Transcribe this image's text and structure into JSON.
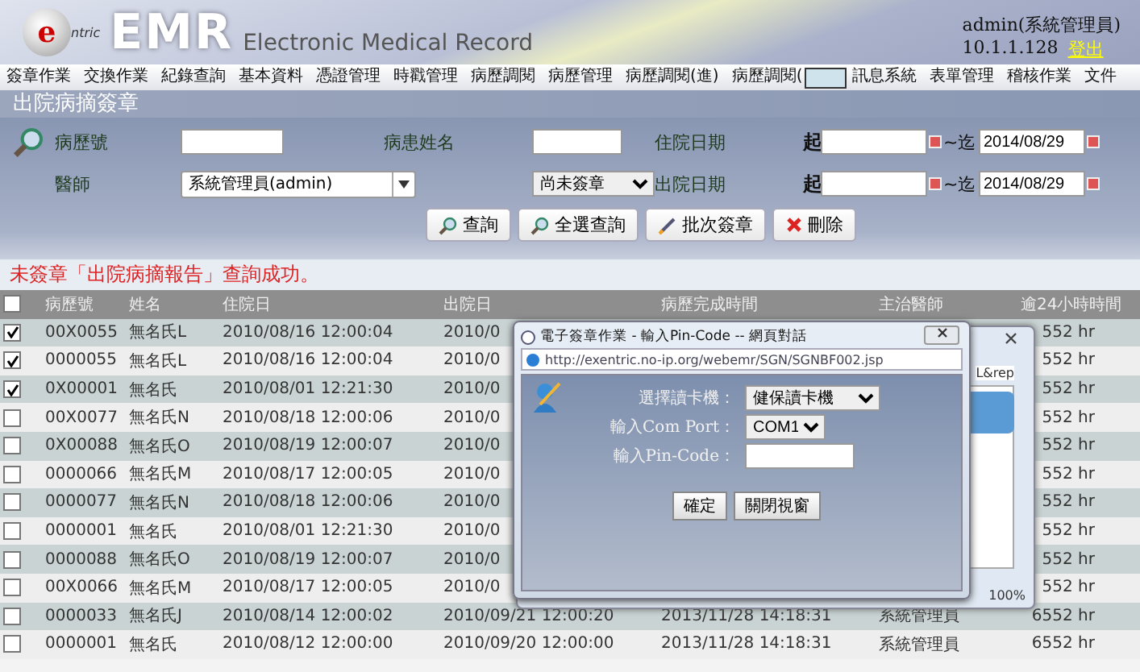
{
  "header": {
    "logo_letter": "e",
    "logo_word": "ntric",
    "product": "EMR",
    "subtitle": "Electronic Medical Record",
    "user": "admin(系統管理員)",
    "ip": "10.1.1.128",
    "logout": "登出"
  },
  "menu": [
    {
      "label": "簽章作業"
    },
    {
      "label": "交換作業"
    },
    {
      "label": "紀錄查詢"
    },
    {
      "label": "基本資料"
    },
    {
      "label": "憑證管理"
    },
    {
      "label": "時戳管理"
    },
    {
      "label": "病歷調閱"
    },
    {
      "label": "病歷管理"
    },
    {
      "label": "病歷調閱(進)"
    },
    {
      "label": "病歷調閱(",
      "covered": true
    },
    {
      "label": "訊息系統"
    },
    {
      "label": "表單管理"
    },
    {
      "label": "稽核作業"
    },
    {
      "label": "文件"
    }
  ],
  "page_title": "出院病摘簽章",
  "filters": {
    "chart_no": {
      "label": "病歷號"
    },
    "patient_name": {
      "label": "病患姓名"
    },
    "admit_date": {
      "label": "住院日期",
      "from_label": "起",
      "to_label": "~迄",
      "to": "2014/08/29"
    },
    "doctor": {
      "label": "醫師",
      "value": "系統管理員(admin)"
    },
    "sign_status": {
      "value": "尚未簽章"
    },
    "discharge_date": {
      "label": "出院日期",
      "from_label": "起",
      "to_label": "~迄",
      "to": "2014/08/29"
    }
  },
  "buttons": [
    {
      "kind": "search",
      "label": "查詢"
    },
    {
      "kind": "search",
      "label": "全選查詢"
    },
    {
      "kind": "sign",
      "label": "批次簽章"
    },
    {
      "kind": "delete",
      "label": "刪除"
    }
  ],
  "message": "未簽章「出院病摘報告」查詢成功。",
  "table": {
    "all_checked": false,
    "columns": [
      "病歷號",
      "姓名",
      "住院日",
      "出院日",
      "病歷完成時間",
      "主治醫師",
      "逾24小時時間"
    ],
    "rows": [
      {
        "checked": true,
        "cells": [
          "00X0055",
          "無名氏L",
          "2010/08/16 12:00:04",
          "2010/0",
          "",
          "",
          "552 hr"
        ]
      },
      {
        "checked": true,
        "cells": [
          "0000055",
          "無名氏L",
          "2010/08/16 12:00:04",
          "2010/0",
          "",
          "",
          "552 hr"
        ]
      },
      {
        "checked": true,
        "cells": [
          "0X00001",
          "無名氏",
          "2010/08/01 12:21:30",
          "2010/0",
          "",
          "",
          "552 hr"
        ]
      },
      {
        "checked": false,
        "cells": [
          "00X0077",
          "無名氏N",
          "2010/08/18 12:00:06",
          "2010/0",
          "",
          "",
          "552 hr"
        ]
      },
      {
        "checked": false,
        "cells": [
          "0X00088",
          "無名氏O",
          "2010/08/19 12:00:07",
          "2010/0",
          "",
          "",
          "552 hr"
        ]
      },
      {
        "checked": false,
        "cells": [
          "0000066",
          "無名氏M",
          "2010/08/17 12:00:05",
          "2010/0",
          "",
          "",
          "552 hr"
        ]
      },
      {
        "checked": false,
        "cells": [
          "0000077",
          "無名氏N",
          "2010/08/18 12:00:06",
          "2010/0",
          "",
          "",
          "552 hr"
        ]
      },
      {
        "checked": false,
        "cells": [
          "0000001",
          "無名氏",
          "2010/08/01 12:21:30",
          "2010/0",
          "",
          "",
          "552 hr"
        ]
      },
      {
        "checked": false,
        "cells": [
          "0000088",
          "無名氏O",
          "2010/08/19 12:00:07",
          "2010/0",
          "",
          "",
          "552 hr"
        ]
      },
      {
        "checked": false,
        "cells": [
          "00X0066",
          "無名氏M",
          "2010/08/17 12:00:05",
          "2010/0",
          "",
          "",
          "552 hr"
        ]
      },
      {
        "checked": false,
        "cells": [
          "0000033",
          "無名氏J",
          "2010/08/14 12:00:02",
          "2010/09/21 12:00:20",
          "2013/11/28 14:18:31",
          "系統管理員",
          "6552 hr"
        ]
      },
      {
        "checked": false,
        "cells": [
          "0000001",
          "無名氏",
          "2010/08/12 12:00:00",
          "2010/09/20 12:00:00",
          "2013/11/28 14:18:31",
          "系統管理員",
          "6552 hr"
        ]
      }
    ]
  },
  "back_window": {
    "address_tail": "L&rep",
    "zoom": "100%"
  },
  "dialog": {
    "title": "電子簽章作業 - 輸入Pin-Code -- 網頁對話",
    "address": "http://exentric.no-ip.org/webemr/SGN/SGNBF002.jsp",
    "reader": {
      "label": "選擇讀卡機：",
      "value": "健保讀卡機"
    },
    "port": {
      "label": "輸入Com Port：",
      "value": "COM1"
    },
    "pin": {
      "label": "輸入Pin-Code："
    },
    "buttons": [
      "確定",
      "關閉視窗"
    ]
  }
}
